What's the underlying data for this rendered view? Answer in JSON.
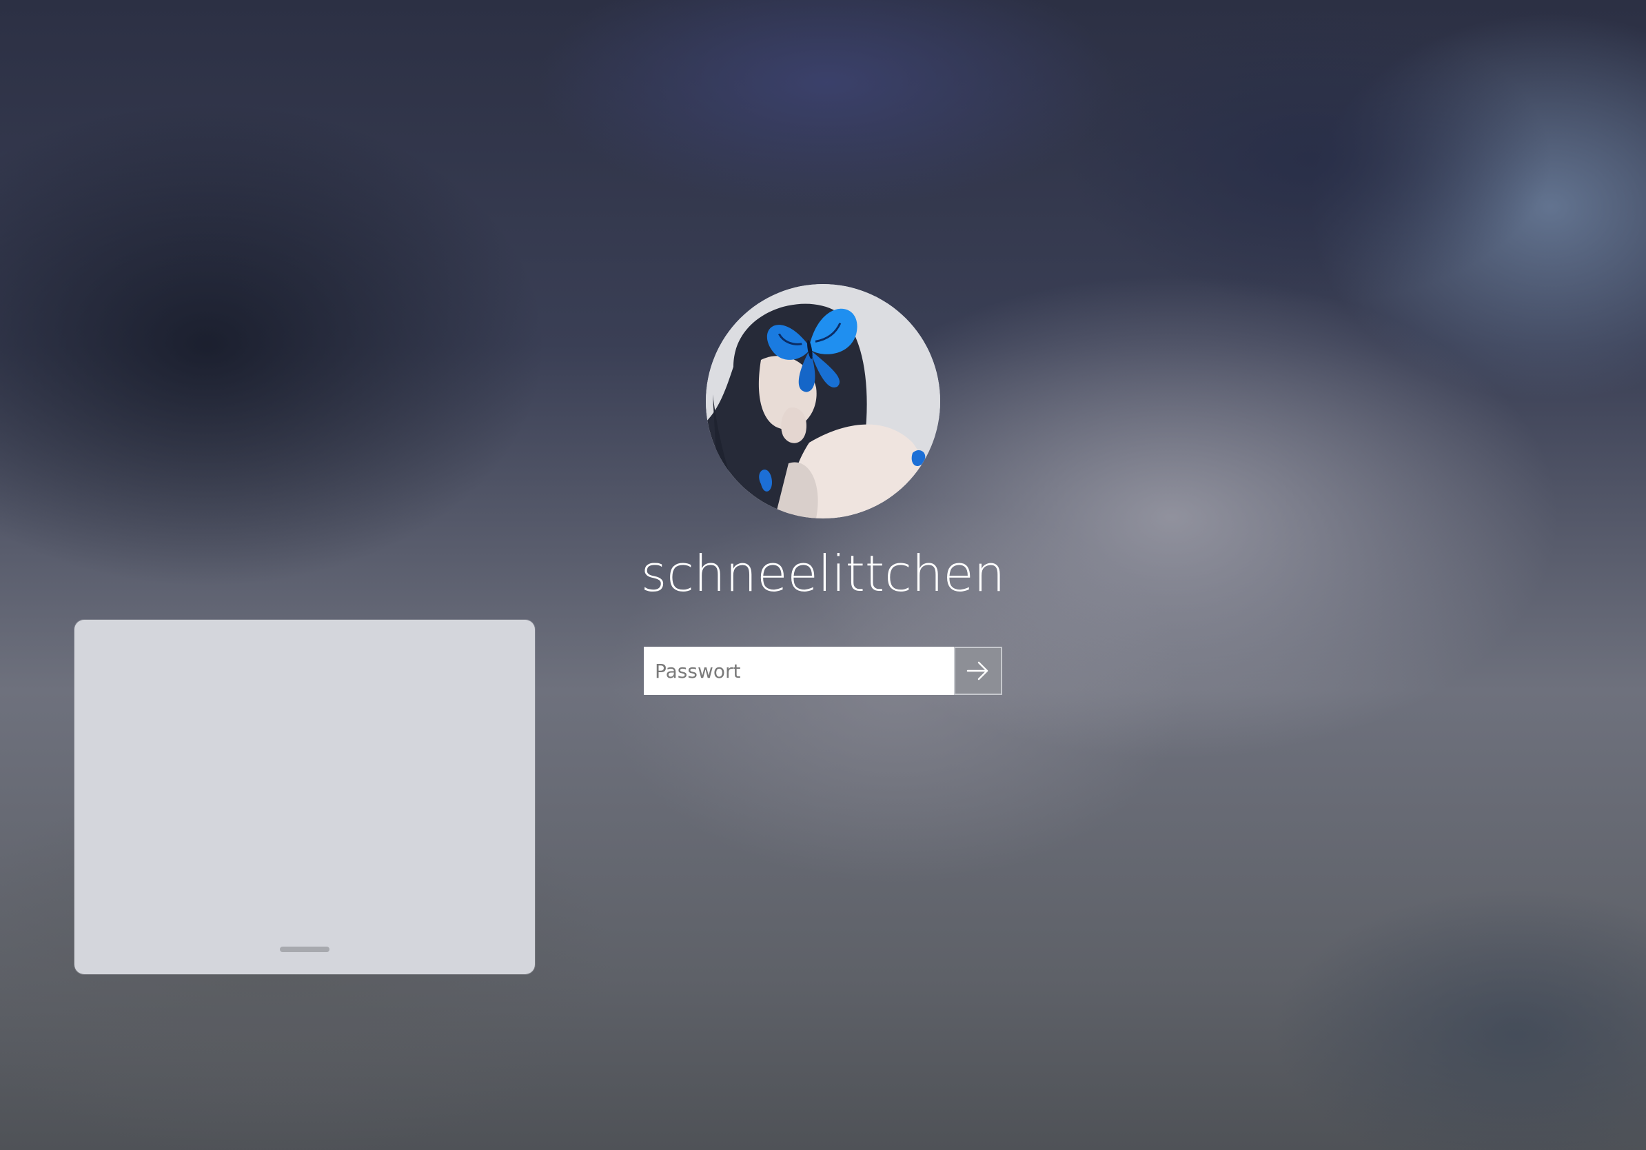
{
  "user": {
    "name": "schneelittchen",
    "avatar_icon": "user-avatar-butterfly"
  },
  "password": {
    "placeholder": "Passwort",
    "value": "",
    "submit_icon": "arrow-right-icon"
  },
  "colors": {
    "input_bg": "#ffffff",
    "submit_bg": "#8d8f96",
    "panel_bg": "#d4d6dc",
    "text": "#ffffff"
  }
}
